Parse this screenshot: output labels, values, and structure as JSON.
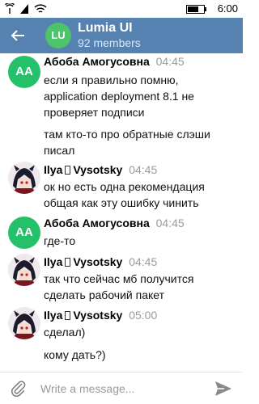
{
  "status": {
    "time": "6:00"
  },
  "header": {
    "avatar_initials": "LU",
    "title": "Lumia UI",
    "subtitle": "92 members"
  },
  "messages": [
    {
      "avatar": "AA",
      "sender": "Абоба Амогусовна",
      "time": "04:45",
      "lines": [
        "если я правильно помню, application deployment 8.1 не проверяет подписи",
        "там кто-то про обратные слэши писал"
      ]
    },
    {
      "avatar": "photo",
      "sender_first": "Ilya",
      "sender_last": "Vysotsky",
      "time": "04:45",
      "lines": [
        "ок но есть одна рекомендация общая как эту ошибку чинить"
      ]
    },
    {
      "avatar": "AA",
      "sender": "Абоба Амогусовна",
      "time": "04:45",
      "lines": [
        "где-то"
      ]
    },
    {
      "avatar": "photo",
      "sender_first": "Ilya",
      "sender_last": "Vysotsky",
      "time": "04:45",
      "lines": [
        "так что сейчас мб получится сделать рабочий пакет"
      ]
    },
    {
      "avatar": "photo",
      "sender_first": "Ilya",
      "sender_last": "Vysotsky",
      "time": "05:00",
      "lines": [
        "сделал)",
        "кому дать?)"
      ]
    }
  ],
  "composer": {
    "placeholder": "Write a message..."
  },
  "colors": {
    "header": "#5682b2",
    "avatar_green": "#25c06a",
    "time_gray": "#9a9a9a"
  },
  "icons": [
    "back-arrow",
    "attach-paperclip",
    "send-arrow",
    "signal",
    "wifi",
    "battery"
  ]
}
